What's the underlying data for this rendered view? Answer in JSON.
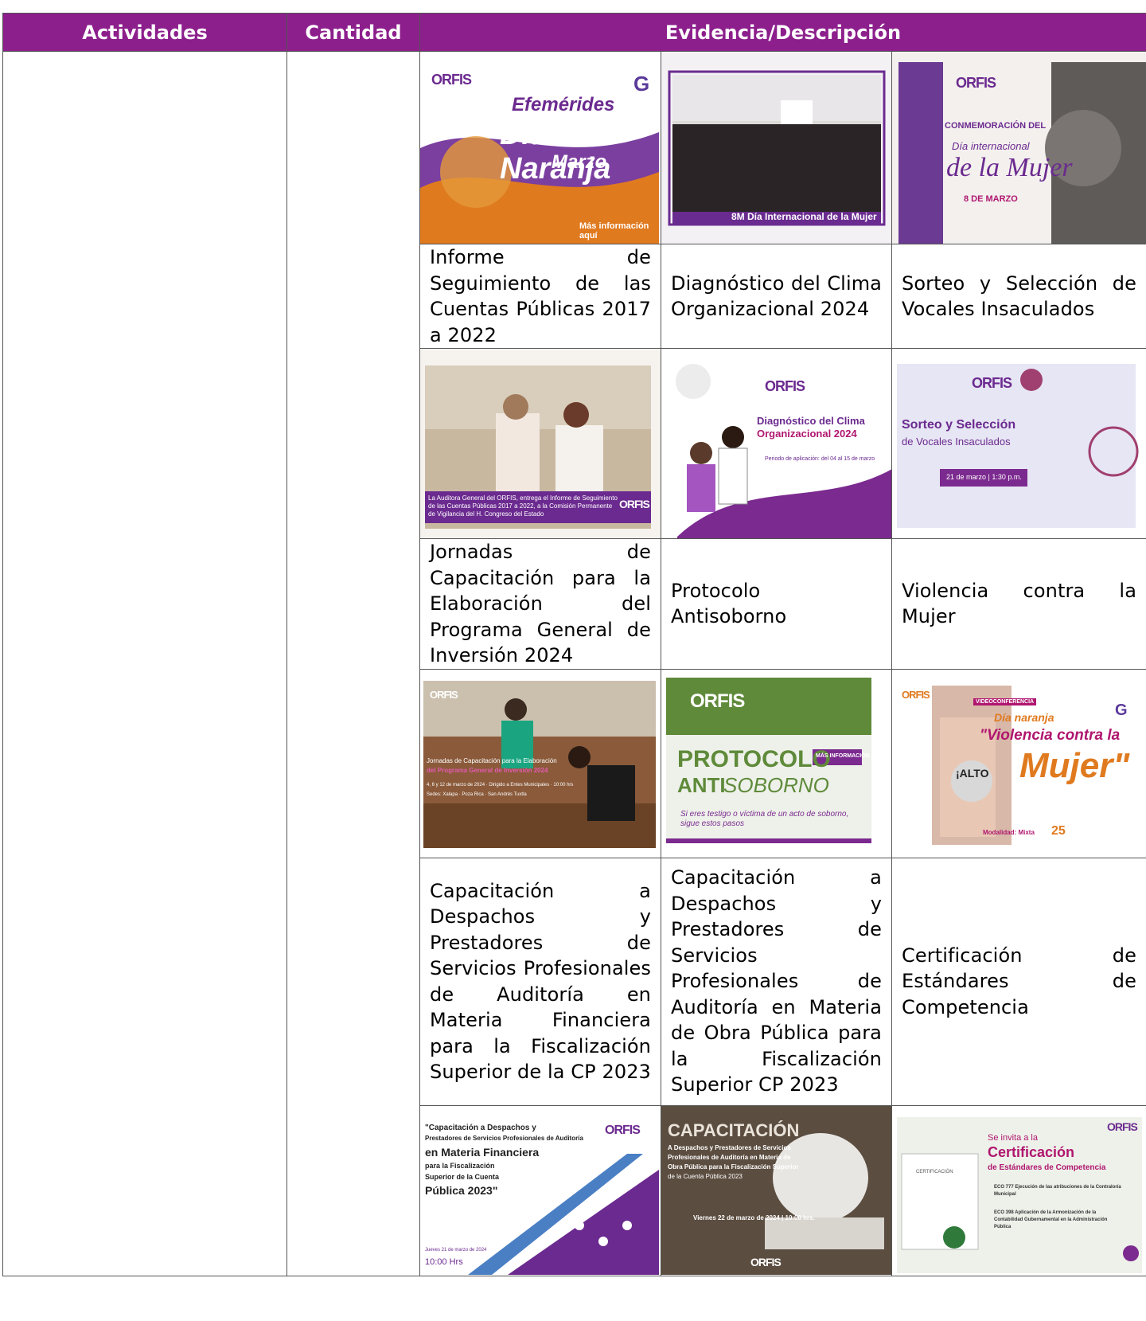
{
  "table": {
    "headers": [
      "Actividades",
      "Cantidad",
      "Evidencia/Descripción"
    ]
  },
  "brand": "ORFIS",
  "rows": {
    "r1_captions": [
      "Informe de Seguimiento de las Cuentas Públicas 2017 a 2022",
      "Diagnóstico del Clima Organizacional 2024",
      "Sorteo y Selección de Vocales Insaculados"
    ],
    "r2_captions": [
      "Jornadas de Capacitación para la Elaboración del Programa General de Inversión 2024",
      "Protocolo Antisoborno",
      "Violencia contra la Mujer"
    ],
    "r3_captions": [
      "Capacitación a Despachos y Prestadores de Servicios Profesionales de Auditoría en Materia Financiera para la Fiscalización Superior de la CP 2023",
      "Capacitación a Despachos y Prestadores de Servicios Profesionales de Auditoría en Materia de Obra Pública para la Fiscalización Superior CP 2023",
      "Certificación de Estándares de Competencia"
    ]
  },
  "posters": {
    "p1": {
      "line1": "Efemérides",
      "line2": "Día Naranja",
      "line3": "Marzo",
      "foot": "Más información aquí"
    },
    "p2": {
      "banner": "8M Día Internacional de la Mujer"
    },
    "p3": {
      "line1": "CONMEMORACIÓN DEL",
      "line2": "Día internacional",
      "line3": "de la Mujer",
      "line4": "8 DE MARZO"
    },
    "p4": {
      "caption": "La Auditora General del ORFIS, entrega el Informe de Seguimiento de las Cuentas Públicas 2017 a 2022, a la Comisión Permanente de Vigilancia del H. Congreso del Estado"
    },
    "p5": {
      "line1": "Diagnóstico del Clima",
      "line2": "Organizacional 2024",
      "line3": "Periodo de aplicación: del 04 al 15 de marzo"
    },
    "p6": {
      "line1": "Sorteo y Selección",
      "line2": "de Vocales Insaculados",
      "line3": "21 de marzo | 1:30 p.m."
    },
    "p7": {
      "line1": "Jornadas de Capacitación para la Elaboración",
      "line2": "del Programa General de Inversión 2024",
      "line3": "4, 6 y 12 de marzo de 2024 · Dirigido a Entes Municipales · 10:00 hrs",
      "line4": "Sedes: Xalapa · Poza Rica · San Andrés Tuxtla"
    },
    "p8": {
      "line1": "PROTOCOLO",
      "line2": "ANTI",
      "line3": "SOBORNO",
      "btn": "MÁS INFORMACIÓN",
      "foot": "Si eres testigo o víctima de un acto de soborno, sigue estos pasos"
    },
    "p9": {
      "tag": "VIDEOCONFERENCIA",
      "line1": "Día naranja",
      "line2": "\"Violencia contra la",
      "line3": "Mujer\"",
      "sign": "¡ALTO",
      "foot": "Modalidad: Mixta",
      "date": "25"
    },
    "p10": {
      "line1": "\"Capacitación a Despachos y",
      "line2": "Prestadores de Servicios Profesionales de Auditoría",
      "line3": "en Materia Financiera",
      "line4": "para la Fiscalización",
      "line5": "Superior de la Cuenta",
      "line6": "Pública 2023\"",
      "line7": "Jueves 21 de marzo de 2024",
      "line8": "10:00 Hrs"
    },
    "p11": {
      "line1": "CAPACITACIÓN",
      "line2": "A Despachos y Prestadores de Servicios",
      "line3": "Profesionales de Auditoría en Materia de",
      "line4": "Obra Pública para la Fiscalización Superior",
      "line5": "de la Cuenta Pública 2023",
      "line6": "Viernes 22 de marzo de 2024 | 10:00 hrs."
    },
    "p12": {
      "line1": "Se invita a la",
      "line2": "Certificación",
      "line3": "de Estándares de Competencia",
      "line4": "ECO 777 Ejecución de las atribuciones de la Contraloría Municipal",
      "line5": "ECO 398 Aplicación de la Armonización de la Contabilidad Gubernamental en la Administración Pública",
      "cert": "CERTIFICACIÓN"
    }
  },
  "colors": {
    "header": "#8c1f8c",
    "purple": "#6b2a8f",
    "orange": "#e07a1f",
    "green": "#5a8a3a",
    "magenta": "#b0166f"
  }
}
